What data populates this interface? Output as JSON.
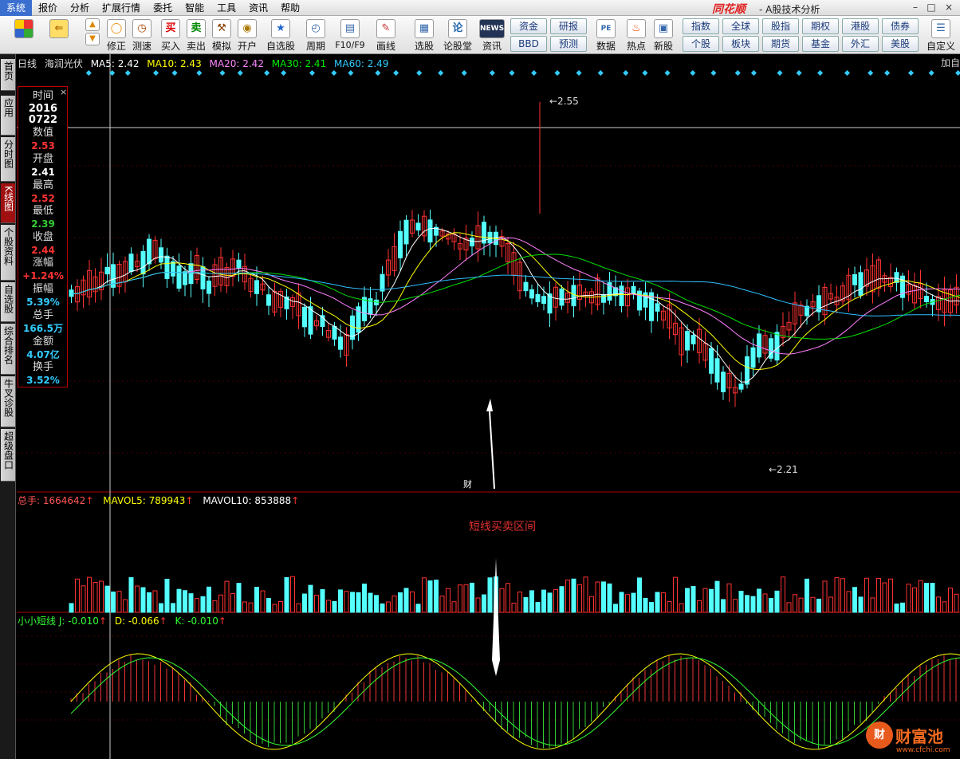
{
  "menubar": {
    "items": [
      "系统",
      "报价",
      "分析",
      "扩展行情",
      "委托",
      "智能",
      "工具",
      "资讯",
      "帮助"
    ],
    "brand": "同花顺",
    "title": "- A股技术分析"
  },
  "toolbar": {
    "buttons": [
      {
        "label": "",
        "icon": "color-grid-icon"
      },
      {
        "label": "",
        "icon": "back-arrow-icon"
      },
      {
        "label": "修正",
        "icon": "wrench-icon"
      },
      {
        "label": "测速",
        "icon": "stopwatch-icon"
      },
      {
        "label": "买入",
        "icon": "buy-icon",
        "glyph": "买"
      },
      {
        "label": "卖出",
        "icon": "sell-icon",
        "glyph": "卖"
      },
      {
        "label": "模拟",
        "icon": "gavel-icon"
      },
      {
        "label": "开户",
        "icon": "lock-icon"
      },
      {
        "label": "自选股",
        "icon": "star-folder-icon"
      },
      {
        "label": "周期",
        "icon": "clock-icon"
      },
      {
        "label": "F10/F9",
        "icon": "document-icon"
      },
      {
        "label": "画线",
        "icon": "pen-icon"
      },
      {
        "label": "选股",
        "icon": "monitor-icon"
      },
      {
        "label": "论股堂",
        "icon": "forum-icon",
        "glyph": "论"
      },
      {
        "label": "资讯",
        "icon": "news-icon",
        "glyph": "NEWS"
      },
      {
        "label": "数据",
        "icon": "pe-icon",
        "glyph": "PE"
      },
      {
        "label": "热点",
        "icon": "hot-icon"
      },
      {
        "label": "新股",
        "icon": "ipo-icon"
      },
      {
        "label": "自定义",
        "icon": "customize-icon"
      }
    ],
    "grid": [
      "资金",
      "研报",
      "BBD",
      "预测",
      "指数",
      "全球",
      "股指",
      "期权",
      "港股",
      "债券",
      "个股",
      "板块",
      "期货",
      "基金",
      "外汇",
      "美股"
    ]
  },
  "leftnav": [
    "首页",
    "应用",
    "分时图",
    "K线图",
    "个股资料",
    "自选股",
    "综合排名",
    "牛叉诊股",
    "超级盘口"
  ],
  "price_header": {
    "period": "日线",
    "stock": "海润光伏",
    "ma5": "MA5: 2.42",
    "ma10": "MA10: 2.43",
    "ma20": "MA20: 2.42",
    "ma30": "MA30: 2.41",
    "ma60": "MA60: 2.49",
    "add": "加自"
  },
  "infobox": {
    "time_label": "时间",
    "year": "2016",
    "date": "0722",
    "value_label": "数值",
    "value": "2.53",
    "open_label": "开盘",
    "open": "2.41",
    "high_label": "最高",
    "high": "2.52",
    "low_label": "最低",
    "low": "2.39",
    "close_label": "收盘",
    "close": "2.44",
    "chg_label": "涨幅",
    "chg": "+1.24%",
    "amp_label": "振幅",
    "amp": "5.39%",
    "vol_label": "总手",
    "vol": "166.5万",
    "amt_label": "金额",
    "amt": "4.07亿",
    "turn_label": "换手",
    "turn": "3.52%"
  },
  "chart_labels": {
    "max": "2.55",
    "min": "2.21",
    "finance_marker": "财"
  },
  "volume_header": {
    "total": "总手: 1664642",
    "mavol5": "MAVOL5: 789943",
    "mavol10": "MAVOL10: 853888"
  },
  "kdj_header": {
    "name": "小小短线",
    "j": "J: -0.010",
    "d": "D: -0.066",
    "k": "K: -0.010"
  },
  "annotation": "短线买卖区间",
  "watermark": {
    "brand": "财富池",
    "url": "www.cfchi.com",
    "glyph": "财"
  },
  "colors": {
    "up": "#ff3232",
    "down": "#54ffff",
    "ma5": "#ffffff",
    "ma10": "#ffff00",
    "ma20": "#ff80ff",
    "ma30": "#00e000",
    "ma60": "#30c0ff"
  }
}
